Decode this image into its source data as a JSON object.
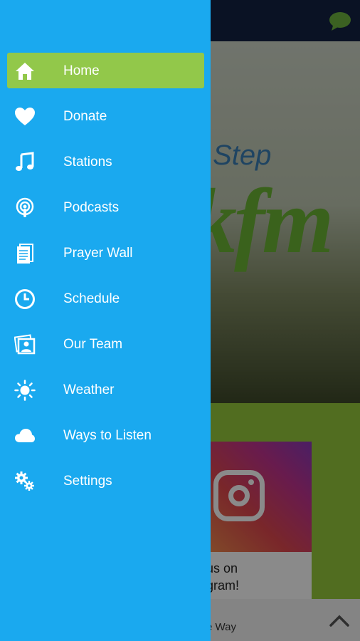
{
  "background": {
    "hero_text_top": "y Step",
    "hero_text_logo": "kfm",
    "instagram_caption_line1": "us on",
    "instagram_caption_line2": "gram!",
    "bottom_text": "e Way"
  },
  "menu": {
    "items": [
      {
        "label": "Home",
        "icon": "home-icon",
        "active": true
      },
      {
        "label": "Donate",
        "icon": "heart-icon"
      },
      {
        "label": "Stations",
        "icon": "music-note-icon"
      },
      {
        "label": "Podcasts",
        "icon": "podcast-icon"
      },
      {
        "label": "Prayer Wall",
        "icon": "document-icon"
      },
      {
        "label": "Schedule",
        "icon": "clock-icon"
      },
      {
        "label": "Our Team",
        "icon": "photo-portrait-icon"
      },
      {
        "label": "Weather",
        "icon": "sun-icon"
      },
      {
        "label": "Ways to Listen",
        "icon": "cloud-icon"
      },
      {
        "label": "Settings",
        "icon": "gears-icon"
      }
    ]
  },
  "colors": {
    "drawer": "#1aa9ef",
    "active": "#92c84a",
    "topbar": "#132243",
    "green_band": "#97c93c"
  }
}
